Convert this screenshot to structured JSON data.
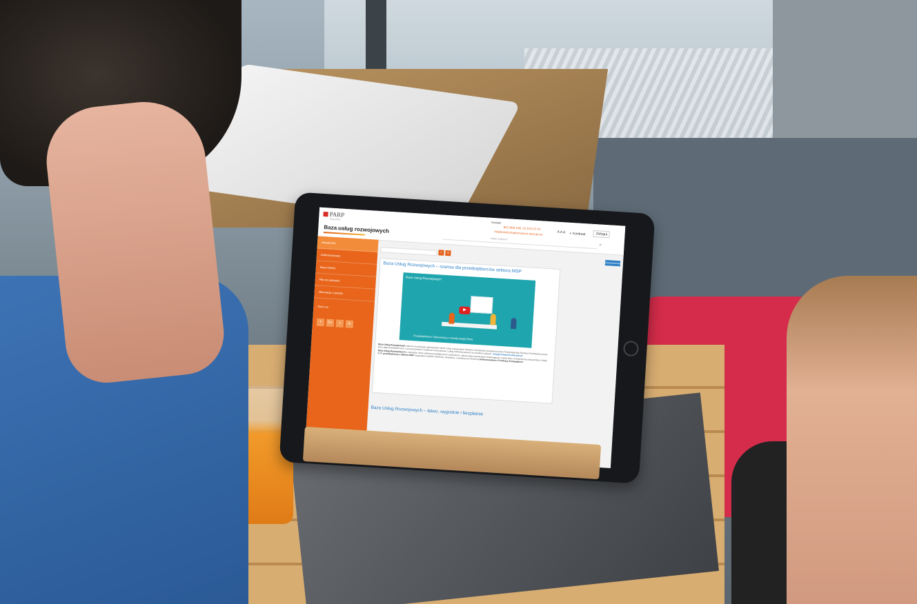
{
  "site": {
    "logo_text": "PARP",
    "logo_sub": "Grupa PFR",
    "title": "Baza usług rozwojowych",
    "search_hint": "Szukaj szkolenia/usługi",
    "search_placeholder": "czego szukasz?",
    "contact_label": "Kontakt",
    "contact_phone": "801 808 108, 22 574 07 07",
    "contact_email": "helpdesk@uslugirozwojowe.parp.gov.pl",
    "font_size": "A A A",
    "contrast": "Kontrast",
    "login": "Zaloguj"
  },
  "sidebar": {
    "items": [
      {
        "label": "Aktualności"
      },
      {
        "label": "Dofinansowanie"
      },
      {
        "label": "Baza wiedzy"
      },
      {
        "label": "Pliki do pobrania"
      },
      {
        "label": "Informacje o portalu"
      }
    ],
    "follow_label": "Śledź nas:",
    "socials": [
      "f",
      "G+",
      "t",
      "in"
    ]
  },
  "filters": {
    "advanced_label": "Zaawansowane"
  },
  "article1": {
    "title": "Baza Usług Rozwojowych – szansa dla przedsiębiorców sektora MSP",
    "video_title": "Baza Usług Rozwojowych",
    "video_banner": "Przedsiębiorco! Zainwestuj w rozwój swojej firmy",
    "p1_bold": "Baza Usług Rozwojowych",
    "p1_link": "uslugirozwojowe.parp.gov.pl",
    "p1_text": "stanowi innowacyjny ogólnopolski rejestr usług rozwojowych (szkoleń, doradztwa) prowadzony przez Polską Agencję Rozwoju Przedsiębiorczości, który daje przedsiębiorcom i ich pracownikom możliwość skorzystania z usług dofinansowanych ze środków unijnych.",
    "p2_bold": "Baza Usług Rozwojowych",
    "p2_text": "to narzędzie, które ułatwia przedsiębiorcom znalezienie i zakup usług rozwojowych wspierających rozwój firmy i kompetencje pracowników. Dzięki BUR",
    "p2_bold2": "przedsiębiorcy z sektora MSP",
    "p2_text2": "mogą łatwo znaleźć szkolenia, doradztwo, coaching czy mentoring",
    "p2_bold3": "dofinansowane z Funduszy Europejskich."
  },
  "article2": {
    "title": "Baza Usług Rozwojowych – łatwo, wygodnie i bezpłatnie"
  }
}
